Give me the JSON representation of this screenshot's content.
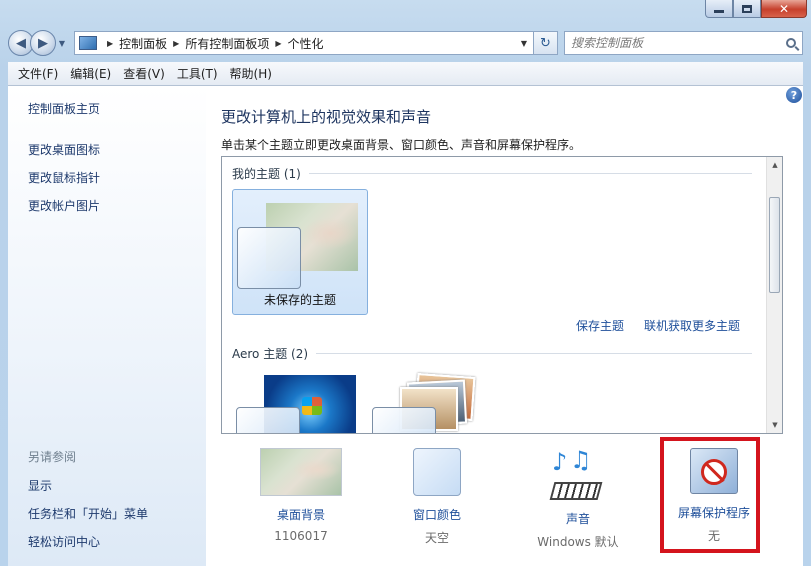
{
  "window": {
    "controls": {
      "minimize": "minimize",
      "maximize": "maximize",
      "close": "✕"
    }
  },
  "address_bar": {
    "breadcrumbs": [
      "控制面板",
      "所有控制面板项",
      "个性化"
    ],
    "search_placeholder": "搜索控制面板"
  },
  "menu": [
    "文件(F)",
    "编辑(E)",
    "查看(V)",
    "工具(T)",
    "帮助(H)"
  ],
  "sidebar": {
    "home": "控制面板主页",
    "links": [
      "更改桌面图标",
      "更改鼠标指针",
      "更改帐户图片"
    ],
    "see_also_header": "另请参阅",
    "see_also": [
      "显示",
      "任务栏和「开始」菜单",
      "轻松访问中心"
    ]
  },
  "main": {
    "title": "更改计算机上的视觉效果和声音",
    "subtitle": "单击某个主题立即更改桌面背景、窗口颜色、声音和屏幕保护程序。",
    "my_themes_header": "我的主题 (1)",
    "unsaved_theme": "未保存的主题",
    "save_theme": "保存主题",
    "get_more_online": "联机获取更多主题",
    "aero_header": "Aero 主题 (2)"
  },
  "options": [
    {
      "label": "桌面背景",
      "value": "1106017"
    },
    {
      "label": "窗口颜色",
      "value": "天空"
    },
    {
      "label": "声音",
      "value": "Windows 默认"
    },
    {
      "label": "屏幕保护程序",
      "value": "无"
    }
  ],
  "icons": {
    "help": "?",
    "back": "◀",
    "forward": "▶",
    "refresh": "↻",
    "dropdown": "▼"
  },
  "colors": {
    "link": "#1e4f9a",
    "highlight": "#d4141d"
  }
}
